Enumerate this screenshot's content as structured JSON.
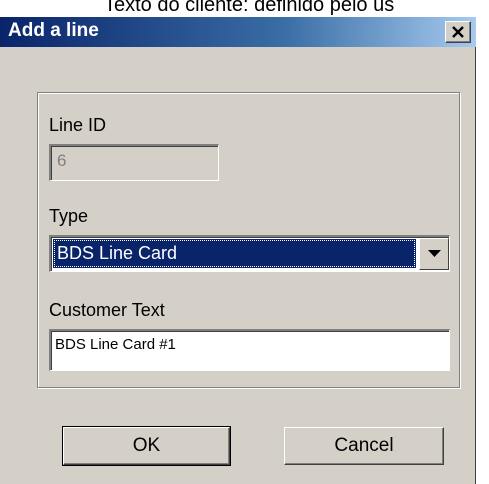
{
  "background": {
    "caption": "Texto do cliente: definido pelo us"
  },
  "dialog": {
    "title": "Add a line",
    "close_label": "close",
    "line_id": {
      "label": "Line ID",
      "value": "6"
    },
    "type": {
      "label": "Type",
      "selected": "BDS Line Card"
    },
    "customer_text": {
      "label": "Customer Text",
      "value": "BDS Line Card #1"
    },
    "buttons": {
      "ok": "OK",
      "cancel": "Cancel"
    }
  },
  "colors": {
    "title_bar": "#0a246a",
    "face": "#d4d0c8",
    "selection": "#0a246a"
  },
  "icons": {
    "close": "close-icon",
    "dropdown": "chevron-down-icon"
  }
}
